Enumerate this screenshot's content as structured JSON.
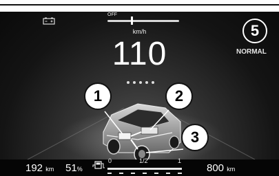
{
  "slider": {
    "label": "OFF"
  },
  "speed": {
    "unit": "km/h",
    "value": "110"
  },
  "drive_mode": {
    "gear": "5",
    "mode": "NORMAL"
  },
  "callouts": [
    "1",
    "2",
    "3"
  ],
  "bottom": {
    "range_left": "192",
    "range_left_unit": "km",
    "charge": "51",
    "charge_unit": "%",
    "fuel_scale": {
      "empty": "0",
      "half": "1/2",
      "full": "1"
    },
    "range_right": "800",
    "range_right_unit": "km"
  },
  "icons": [
    "battery-icon",
    "fuel-pump-icon"
  ]
}
